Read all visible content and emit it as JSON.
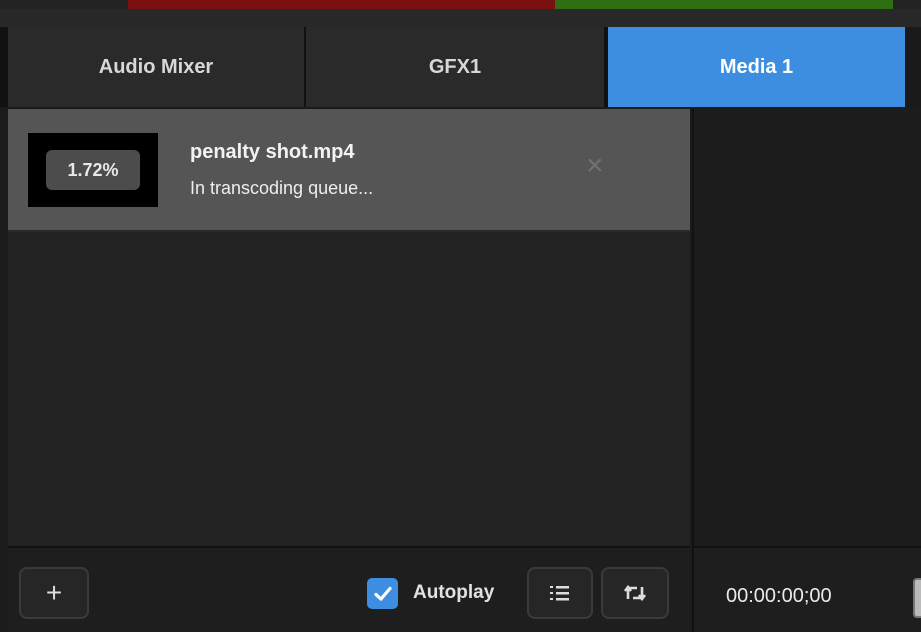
{
  "tabs": [
    {
      "label": "Audio Mixer",
      "active": false
    },
    {
      "label": "GFX1",
      "active": false
    },
    {
      "label": "Media 1",
      "active": true
    }
  ],
  "media_items": [
    {
      "progress_label": "1.72%",
      "filename": "penalty shot.mp4",
      "status": "In transcoding queue...",
      "remove_icon": "close-icon"
    }
  ],
  "toolbar": {
    "add_label": "+",
    "autoplay_label": "Autoplay",
    "autoplay_checked": true,
    "playlist_icon": "list-icon",
    "loop_icon": "loop-icon"
  },
  "transport": {
    "timecode": "00:00:00;00"
  },
  "colors": {
    "accent": "#3d8ee0",
    "meter_red": "#7a1111",
    "meter_green": "#2f6e12"
  }
}
